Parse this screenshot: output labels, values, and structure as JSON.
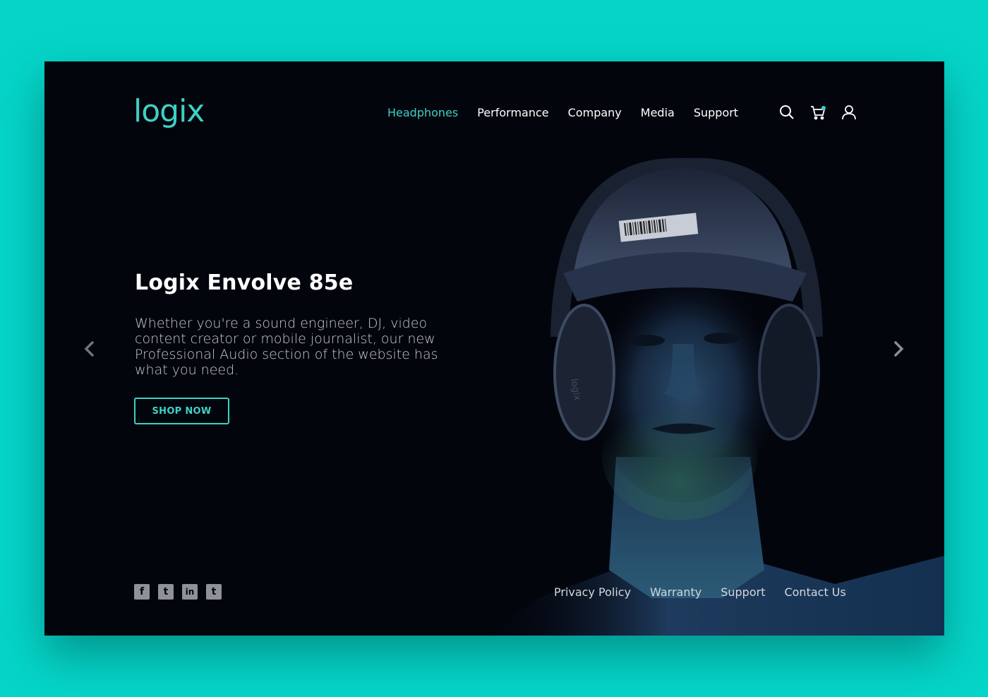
{
  "brand": {
    "logo_text": "logix",
    "accent_color": "#3fd0c4",
    "page_background": "#05d5c8",
    "frame_background": "#03050d"
  },
  "nav": {
    "items": [
      {
        "label": "Headphones",
        "active": true
      },
      {
        "label": "Performance",
        "active": false
      },
      {
        "label": "Company",
        "active": false
      },
      {
        "label": "Media",
        "active": false
      },
      {
        "label": "Support",
        "active": false
      }
    ],
    "icons": [
      "search-icon",
      "cart-icon",
      "user-icon"
    ]
  },
  "hero": {
    "title": "Logix Envolve 85e",
    "description": "Whether you're a sound engineer, DJ, video content creator or mobile journalist, our new Professional Audio section of the website has what you need.",
    "cta_label": "SHOP NOW",
    "image_subject": "man wearing cap and over-ear headphones",
    "headphone_brand_text": "logix"
  },
  "carousel": {
    "prev_icon": "chevron-left-icon",
    "next_icon": "chevron-right-icon"
  },
  "footer": {
    "social": [
      {
        "name": "facebook-icon",
        "glyph": "f"
      },
      {
        "name": "twitter-icon",
        "glyph": "t"
      },
      {
        "name": "linkedin-icon",
        "glyph": "in"
      },
      {
        "name": "tumblr-icon",
        "glyph": "t"
      }
    ],
    "links": [
      "Privacy Policy",
      "Warranty",
      "Support",
      "Contact Us"
    ]
  }
}
